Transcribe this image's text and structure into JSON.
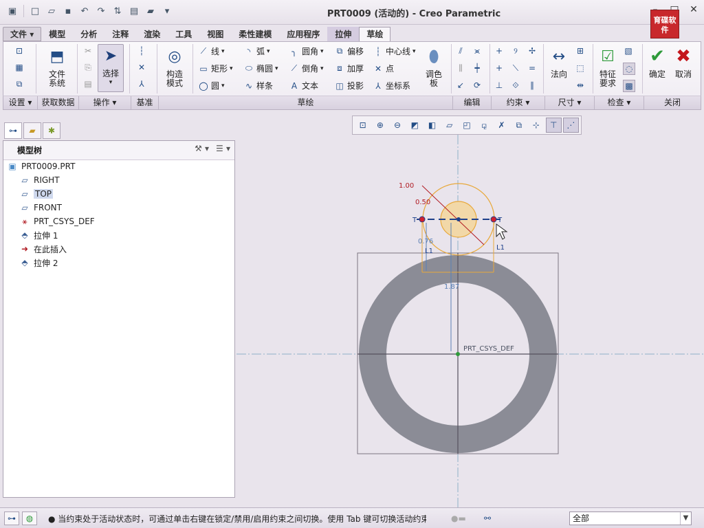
{
  "window": {
    "title": "PRT0009 (活动的) - Creo Parametric",
    "logo_text": "育碟软件"
  },
  "quick_access": {
    "icons": [
      "new-icon",
      "open-icon",
      "save-icon",
      "undo-icon",
      "redo-icon",
      "regenerate-icon",
      "windows-icon",
      "close-window-icon",
      "customize-icon"
    ]
  },
  "tabs": [
    {
      "label": "文件",
      "arrow": "▾"
    },
    {
      "label": "模型"
    },
    {
      "label": "分析"
    },
    {
      "label": "注释"
    },
    {
      "label": "渲染"
    },
    {
      "label": "工具"
    },
    {
      "label": "视图"
    },
    {
      "label": "柔性建模"
    },
    {
      "label": "应用程序"
    },
    {
      "label": "拉伸"
    },
    {
      "label": "草绘"
    }
  ],
  "ribbon": {
    "file_system": "文件\n系统",
    "select": "选择",
    "construction_mode": "构造\n模式",
    "line": "线",
    "rectangle": "矩形",
    "circle": "圆",
    "arc": "弧",
    "ellipse": "椭圆",
    "spline": "样条",
    "fillet": "圆角",
    "chamfer": "倒角",
    "text": "文本",
    "offset": "偏移",
    "thicken": "加厚",
    "project": "投影",
    "centerline": "中心线",
    "point": "点",
    "coord_sys": "坐标系",
    "palette": "调色\n板",
    "normal": "法向",
    "feature_req": "特征\n要求",
    "ok": "确定",
    "cancel": "取消"
  },
  "group_labels": [
    {
      "label": "设置",
      "arrow": "▾"
    },
    {
      "label": "获取数据"
    },
    {
      "label": "操作",
      "arrow": "▾"
    },
    {
      "label": "基准"
    },
    {
      "label": "草绘"
    },
    {
      "label": "编辑"
    },
    {
      "label": "约束",
      "arrow": "▾"
    },
    {
      "label": "尺寸",
      "arrow": "▾"
    },
    {
      "label": "检查",
      "arrow": "▾"
    },
    {
      "label": "关闭"
    }
  ],
  "model_tree": {
    "title": "模型树",
    "items": [
      "PRT0009.PRT",
      "RIGHT",
      "TOP",
      "FRONT",
      "PRT_CSYS_DEF",
      "拉伸 1",
      "在此插入",
      "拉伸 2"
    ]
  },
  "sketch": {
    "dim_diameter_outer": "1.00",
    "dim_radius": "0.50",
    "dim_vertical": "0.76",
    "dim_height": "1.87",
    "csys_label": "PRT_CSYS_DEF",
    "constraint_t": "T",
    "constraint_l1": "L1"
  },
  "status": {
    "message": "● 当约束处于活动状态时，可通过单击右键在锁定/禁用/启用约束之间切换。使用 Tab 键可切换活动约束。按住",
    "filter_value": "全部"
  },
  "colors": {
    "ring": "#8b8c96",
    "sketch_dim": "#5a7fb4",
    "sketch_red": "#b01a22",
    "circle_fill": "#f2d8a8",
    "circle_stroke": "#e8a83a",
    "ok_green": "#2e9a3a",
    "cancel_red": "#c4161c"
  }
}
